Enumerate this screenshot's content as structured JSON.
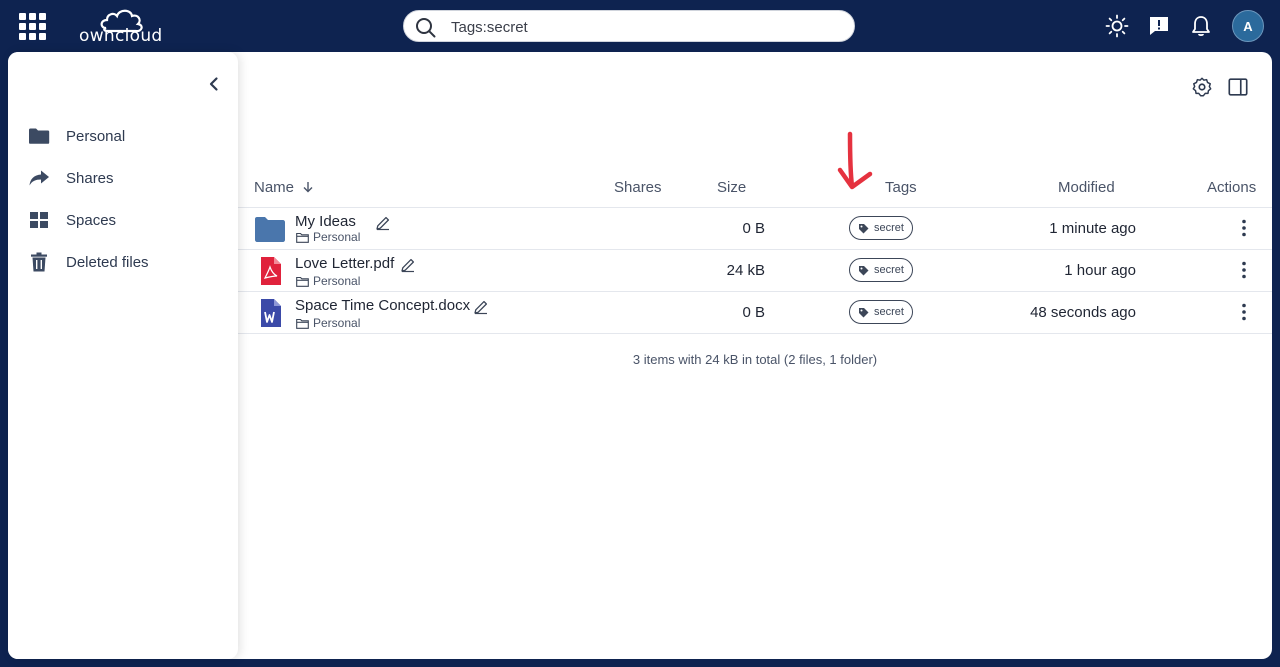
{
  "app": {
    "logo_text": "owncloud",
    "search_value": "Tags:secret",
    "avatar_initial": "A"
  },
  "sidebar": {
    "items": [
      {
        "label": "Personal",
        "icon": "folder-icon"
      },
      {
        "label": "Shares",
        "icon": "share-icon"
      },
      {
        "label": "Spaces",
        "icon": "spaces-icon"
      },
      {
        "label": "Deleted files",
        "icon": "trash-icon"
      }
    ]
  },
  "table": {
    "columns": {
      "name": "Name",
      "shares": "Shares",
      "size": "Size",
      "tags": "Tags",
      "modified": "Modified",
      "actions": "Actions"
    },
    "rows": [
      {
        "name": "My Ideas",
        "location": "Personal",
        "size": "0 B",
        "tag": "secret",
        "modified": "1 minute ago",
        "type": "folder"
      },
      {
        "name": "Love Letter.pdf",
        "location": "Personal",
        "size": "24 kB",
        "tag": "secret",
        "modified": "1 hour ago",
        "type": "pdf"
      },
      {
        "name": "Space Time Concept.docx",
        "location": "Personal",
        "size": "0 B",
        "tag": "secret",
        "modified": "48 seconds ago",
        "type": "docx"
      }
    ]
  },
  "footer": "3 items with 24 kB in total (2 files, 1 folder)",
  "colors": {
    "topbar": "#0e2350",
    "folder": "#4a76ac",
    "pdf": "#e0223c",
    "docx": "#3b4aa8",
    "annotation_arrow": "#e5323f"
  }
}
